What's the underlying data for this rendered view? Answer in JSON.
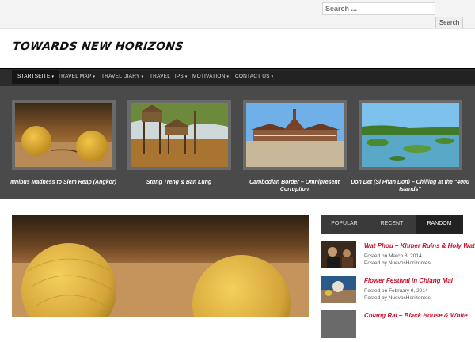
{
  "search": {
    "placeholder": "Search ...",
    "button_label": "Search"
  },
  "site": {
    "title": "TOWARDS NEW HORIZONS"
  },
  "nav": {
    "items": [
      {
        "label": "STARTSEITE"
      },
      {
        "label": "TRAVEL MAP"
      },
      {
        "label": "TRAVEL DIARY"
      },
      {
        "label": "TRAVEL TIPS"
      },
      {
        "label": "MOTIVATION"
      },
      {
        "label": "CONTACT US"
      }
    ],
    "caret": "▾"
  },
  "carousel": {
    "slides": [
      {
        "caption": "Mnibus Madness to Siem Reap (Angkor)"
      },
      {
        "caption": "Stung Treng & Ban Lung"
      },
      {
        "caption": "Cambodian Border – Omnipresent Corruption"
      },
      {
        "caption": "Don Det (Si Phan Don) – Chilling at the \"4000 Islands\""
      }
    ]
  },
  "sidebar": {
    "tabs": [
      {
        "label": "POPULAR"
      },
      {
        "label": "RECENT"
      },
      {
        "label": "RANDOM"
      }
    ],
    "posts": [
      {
        "title": "Wat Phou – Khmer Ruins & Holy Water",
        "date": "Posted on March 8, 2014",
        "author": "Posted by NuevosHorizontes"
      },
      {
        "title": "Flower Festival in Chiang Mai",
        "date": "Posted on February 9, 2014",
        "author": "Posted by NuevosHorizontes"
      },
      {
        "title": "Chiang Rai – Black House & White",
        "date": "",
        "author": ""
      }
    ]
  },
  "colors": {
    "accent": "#c8102e",
    "nav_bg": "#222222",
    "carousel_bg": "#4a4a4a"
  }
}
